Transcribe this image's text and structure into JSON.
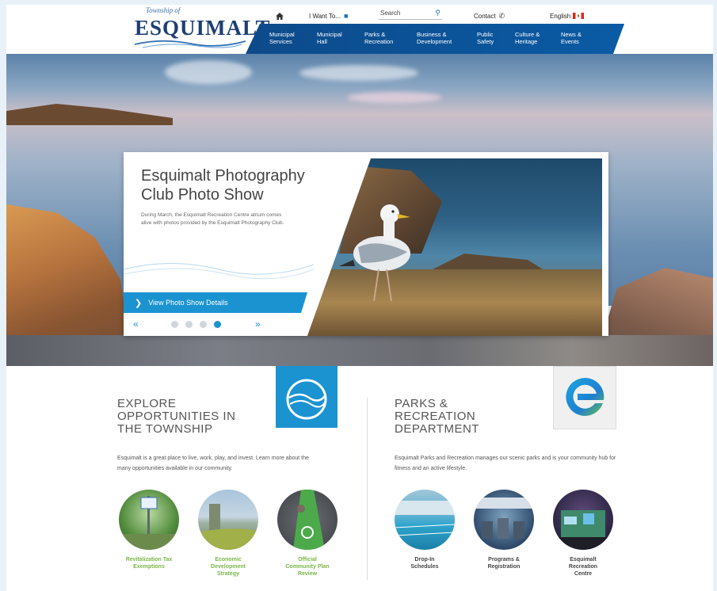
{
  "header": {
    "logo": {
      "small": "Township of",
      "main": "ESQUIMALT"
    },
    "utility": {
      "home_icon": "home-icon",
      "i_want_to": "I Want To...",
      "search_placeholder": "Search",
      "contact": "Contact",
      "language": "English"
    },
    "nav": [
      {
        "line1": "Municipal",
        "line2": "Services"
      },
      {
        "line1": "Municipal",
        "line2": "Hall"
      },
      {
        "line1": "Parks &",
        "line2": "Recreation"
      },
      {
        "line1": "Business &",
        "line2": "Development"
      },
      {
        "line1": "Public",
        "line2": "Safety"
      },
      {
        "line1": "Culture &",
        "line2": "Heritage"
      },
      {
        "line1": "News &",
        "line2": "Events"
      }
    ]
  },
  "slide": {
    "title": "Esquimalt Photography Club Photo Show",
    "text": "During March, the Esquimalt Recreation Centre atrium comes alive with photos provided by the Esquimalt Photography Club.",
    "cta": "View Photo Show Details",
    "active_index": 3
  },
  "explore": {
    "title_lines": [
      "EXPLORE",
      "OPPORTUNITIES IN",
      "THE TOWNSHIP"
    ],
    "text": "Esquimalt is a great place to live, work, play, and invest. Learn more about the many opportunities available in our community.",
    "items": [
      {
        "label1": "Revitalization Tax",
        "label2": "Exemptions",
        "label3": ""
      },
      {
        "label1": "Economic",
        "label2": "Development",
        "label3": "Strategy"
      },
      {
        "label1": "Official",
        "label2": "Community Plan",
        "label3": "Review"
      }
    ]
  },
  "parks": {
    "title_lines": [
      "PARKS &",
      "RECREATION",
      "DEPARTMENT"
    ],
    "text": "Esquimalt Parks and Recreation manages our scenic parks and is your community hub for fitness and an active lifestyle.",
    "items": [
      {
        "label1": "Drop-In",
        "label2": "Schedules",
        "label3": ""
      },
      {
        "label1": "Programs &",
        "label2": "Registration",
        "label3": ""
      },
      {
        "label1": "Esquimalt",
        "label2": "Recreation",
        "label3": "Centre"
      }
    ]
  },
  "colors": {
    "brand_blue": "#0d4a8a",
    "accent_blue": "#1b93d1",
    "link_green": "#7ab648"
  }
}
